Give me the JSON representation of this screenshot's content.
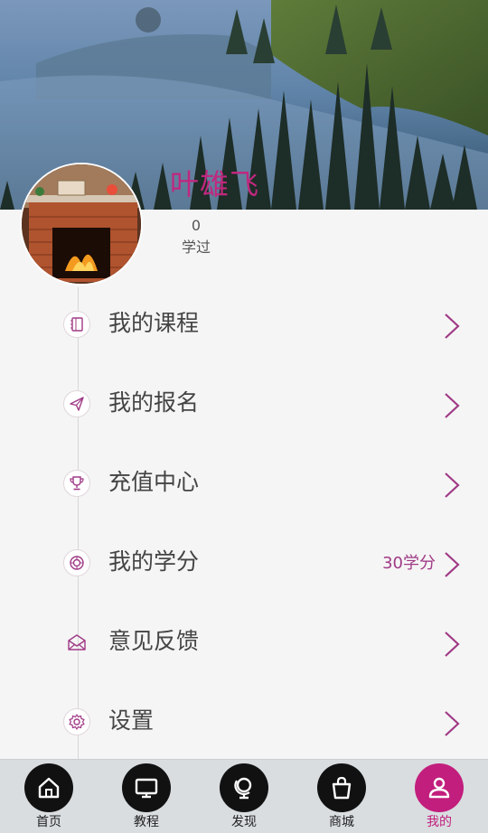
{
  "profile": {
    "name": "叶雄飞",
    "stats": {
      "count": "0",
      "label": "学过"
    }
  },
  "menu": [
    {
      "label": "我的课程",
      "icon": "notebook-icon",
      "extra": ""
    },
    {
      "label": "我的报名",
      "icon": "paper-plane-icon",
      "extra": ""
    },
    {
      "label": "充值中心",
      "icon": "trophy-icon",
      "extra": ""
    },
    {
      "label": "我的学分",
      "icon": "target-icon",
      "extra": "30学分"
    },
    {
      "label": "意见反馈",
      "icon": "envelope-icon",
      "extra": ""
    },
    {
      "label": "设置",
      "icon": "gear-icon",
      "extra": ""
    }
  ],
  "nav": [
    {
      "label": "首页",
      "icon": "home-icon",
      "active": false
    },
    {
      "label": "教程",
      "icon": "monitor-icon",
      "active": false
    },
    {
      "label": "发现",
      "icon": "globe-icon",
      "active": false
    },
    {
      "label": "商城",
      "icon": "shopping-bag-icon",
      "active": false
    },
    {
      "label": "我的",
      "icon": "person-icon",
      "active": true
    }
  ],
  "colors": {
    "accent": "#c21e7d",
    "extra_text": "#a03a86",
    "nav_bg": "#d9dde0"
  }
}
